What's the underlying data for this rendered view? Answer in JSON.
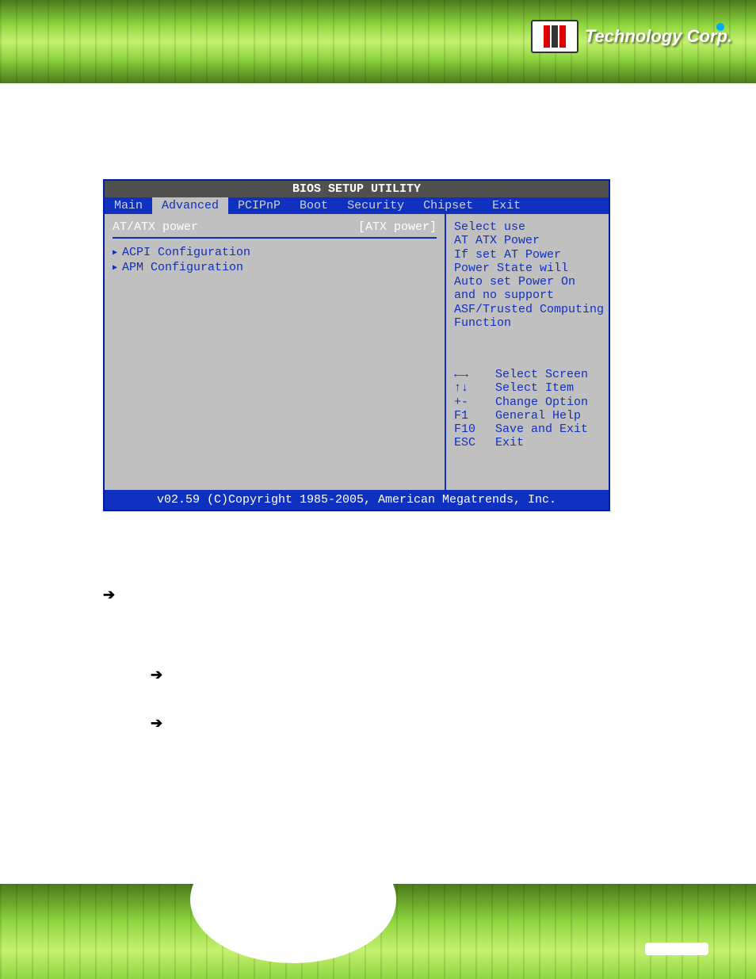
{
  "header": {
    "logo_text": "Technology Corp."
  },
  "bios": {
    "title": "BIOS SETUP UTILITY",
    "tabs": [
      "Main",
      "Advanced",
      "PCIPnP",
      "Boot",
      "Security",
      "Chipset",
      "Exit"
    ],
    "active_tab": "Advanced",
    "left": {
      "setting_label": "AT/ATX power",
      "setting_value": "[ATX power]",
      "submenus": [
        "ACPI Configuration",
        "APM Configuration"
      ]
    },
    "right": {
      "help_lines": [
        "Select use",
        "AT ATX Power",
        "If set AT Power",
        "Power State will",
        "Auto set Power On",
        "and no support",
        "ASF/Trusted Computing",
        "Function"
      ],
      "keys": [
        {
          "k": "←→",
          "d": "Select Screen"
        },
        {
          "k": "↑↓",
          "d": "Select Item"
        },
        {
          "k": "+-",
          "d": "Change Option"
        },
        {
          "k": "F1",
          "d": "General Help"
        },
        {
          "k": "F10",
          "d": "Save and Exit"
        },
        {
          "k": "ESC",
          "d": "Exit"
        }
      ]
    },
    "footer": "v02.59 (C)Copyright 1985-2005, American Megatrends, Inc."
  }
}
